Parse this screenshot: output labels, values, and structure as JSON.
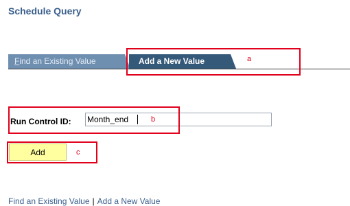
{
  "page": {
    "title": "Schedule Query"
  },
  "tabs": [
    {
      "label": "Find an Existing Value",
      "accesskey_letter": "F",
      "rest": "ind an Existing Value",
      "active": false
    },
    {
      "label": "Add a New Value",
      "active": true
    }
  ],
  "form": {
    "run_control_label": "Run Control ID:",
    "run_control_value": "Month_end",
    "add_button_label": "Add"
  },
  "annotations": {
    "a": "a",
    "b": "b",
    "c": "c",
    "color": "#e0001b"
  },
  "footer_links": {
    "find_existing": "Find an Existing Value",
    "separator": "|",
    "add_new": "Add a New Value"
  },
  "colors": {
    "accent": "#3a5f8d",
    "active_tab": "#355979",
    "inactive_tab": "#6f8fb0",
    "button_bg": "#ffff9f"
  }
}
